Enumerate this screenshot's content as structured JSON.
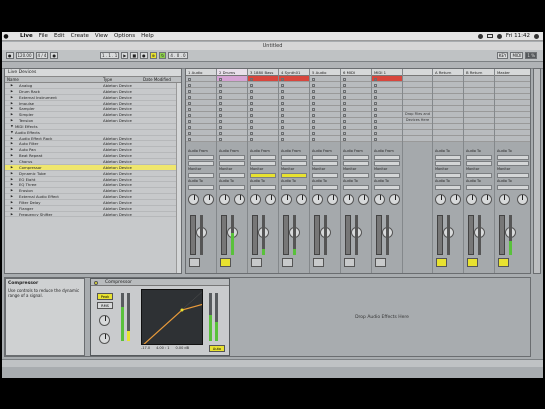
{
  "menubar": {
    "apple": "",
    "app": "Live",
    "items": [
      "File",
      "Edit",
      "Create",
      "View",
      "Options",
      "Help"
    ],
    "clock": "Fri 11:42"
  },
  "window": {
    "title": "Untitled"
  },
  "transport": {
    "tempo": "120.00",
    "sig": "4 / 4",
    "pos": "1 . 1 . 1",
    "len": "4 . 0 . 0",
    "key": "KEY",
    "midi": "MIDI",
    "cpu": "1 %"
  },
  "browser": {
    "header": "Live Devices",
    "columns": {
      "name": "Name",
      "type": "Type",
      "date": "Date Modified"
    },
    "rows": [
      {
        "name": "Analog",
        "type": "Ableton Device",
        "kind": "sub"
      },
      {
        "name": "Drum Rack",
        "type": "Ableton Device",
        "kind": "sub"
      },
      {
        "name": "External Instrument",
        "type": "Ableton Device",
        "kind": "sub"
      },
      {
        "name": "Impulse",
        "type": "Ableton Device",
        "kind": "sub"
      },
      {
        "name": "Sampler",
        "type": "Ableton Device",
        "kind": "sub"
      },
      {
        "name": "Simpler",
        "type": "Ableton Device",
        "kind": "sub"
      },
      {
        "name": "Tension",
        "type": "Ableton Device",
        "kind": "sub"
      },
      {
        "name": "MIDI Effects",
        "type": "",
        "kind": "folder"
      },
      {
        "name": "Audio Effects",
        "type": "",
        "kind": "folder"
      },
      {
        "name": "Audio Effect Rack",
        "type": "Ableton Device",
        "kind": "sub"
      },
      {
        "name": "Auto Filter",
        "type": "Ableton Device",
        "kind": "sub"
      },
      {
        "name": "Auto Pan",
        "type": "Ableton Device",
        "kind": "sub"
      },
      {
        "name": "Beat Repeat",
        "type": "Ableton Device",
        "kind": "sub"
      },
      {
        "name": "Chorus",
        "type": "Ableton Device",
        "kind": "sub"
      },
      {
        "name": "Compressor",
        "type": "Ableton Device",
        "kind": "sel"
      },
      {
        "name": "Dynamic Tube",
        "type": "Ableton Device",
        "kind": "sub"
      },
      {
        "name": "EQ Eight",
        "type": "Ableton Device",
        "kind": "sub"
      },
      {
        "name": "EQ Three",
        "type": "Ableton Device",
        "kind": "sub"
      },
      {
        "name": "Erosion",
        "type": "Ableton Device",
        "kind": "sub"
      },
      {
        "name": "External Audio Effect",
        "type": "Ableton Device",
        "kind": "sub"
      },
      {
        "name": "Filter Delay",
        "type": "Ableton Device",
        "kind": "sub"
      },
      {
        "name": "Flanger",
        "type": "Ableton Device",
        "kind": "sub"
      },
      {
        "name": "Frequency Shifter",
        "type": "Ableton Device",
        "kind": "sub"
      }
    ]
  },
  "session": {
    "tracks": [
      {
        "name": "1 Audio",
        "sel": false,
        "clip": ""
      },
      {
        "name": "2 Drums",
        "sel": true,
        "clip": "pink"
      },
      {
        "name": "3 1880 Bass",
        "sel": false,
        "clip": "red"
      },
      {
        "name": "4 Synth01",
        "sel": false,
        "clip": "red"
      },
      {
        "name": "5 Audio",
        "sel": false,
        "clip": ""
      },
      {
        "name": "6 MIDI",
        "sel": false,
        "clip": ""
      },
      {
        "name": "MIDI 1",
        "sel": false,
        "clip": "red"
      },
      {
        "name": "",
        "sel": false,
        "clip": ""
      },
      {
        "name": "A Return",
        "sel": false,
        "clip": ""
      },
      {
        "name": "B Return",
        "sel": false,
        "clip": ""
      },
      {
        "name": "Master",
        "sel": false,
        "clip": ""
      }
    ],
    "drop_hint_1": "Drop Files and",
    "drop_hint_2": "Devices Here",
    "audio_from": "Audio From",
    "monitor": "Monitor",
    "audio_to": "Audio To",
    "master": "Master",
    "in": "In",
    "auto": "Auto",
    "off": "Off",
    "sends": "Sends",
    "cue_out": "Cue Out",
    "master_out": "Master Out"
  },
  "detail": {
    "info_title": "Compressor",
    "info_text": "Use controls to reduce the dynamic range of a signal.",
    "device_name": "Compressor",
    "labels": {
      "thresh": "Thresh",
      "ratio": "Ratio",
      "attack": "Attack",
      "release": "Release",
      "knee": "Knee",
      "lookahead": "Lookahead",
      "makeup": "Makeup",
      "out": "Out",
      "gr": "GR",
      "peak": "Peak",
      "rms": "RMS",
      "auto": "Auto"
    },
    "values": {
      "thresh": "-17.0",
      "ratio": "4.00 : 1",
      "attack": "0.18 ms",
      "release": "50.0 ms",
      "out": "0.00 dB"
    },
    "dropzone": "Drop Audio Effects Here"
  },
  "status": {
    "text": ""
  },
  "colors": {
    "accent": "#e8e230",
    "clip_red": "#d7463d",
    "clip_pink": "#d5a3d4",
    "meter": "#59c13b"
  }
}
